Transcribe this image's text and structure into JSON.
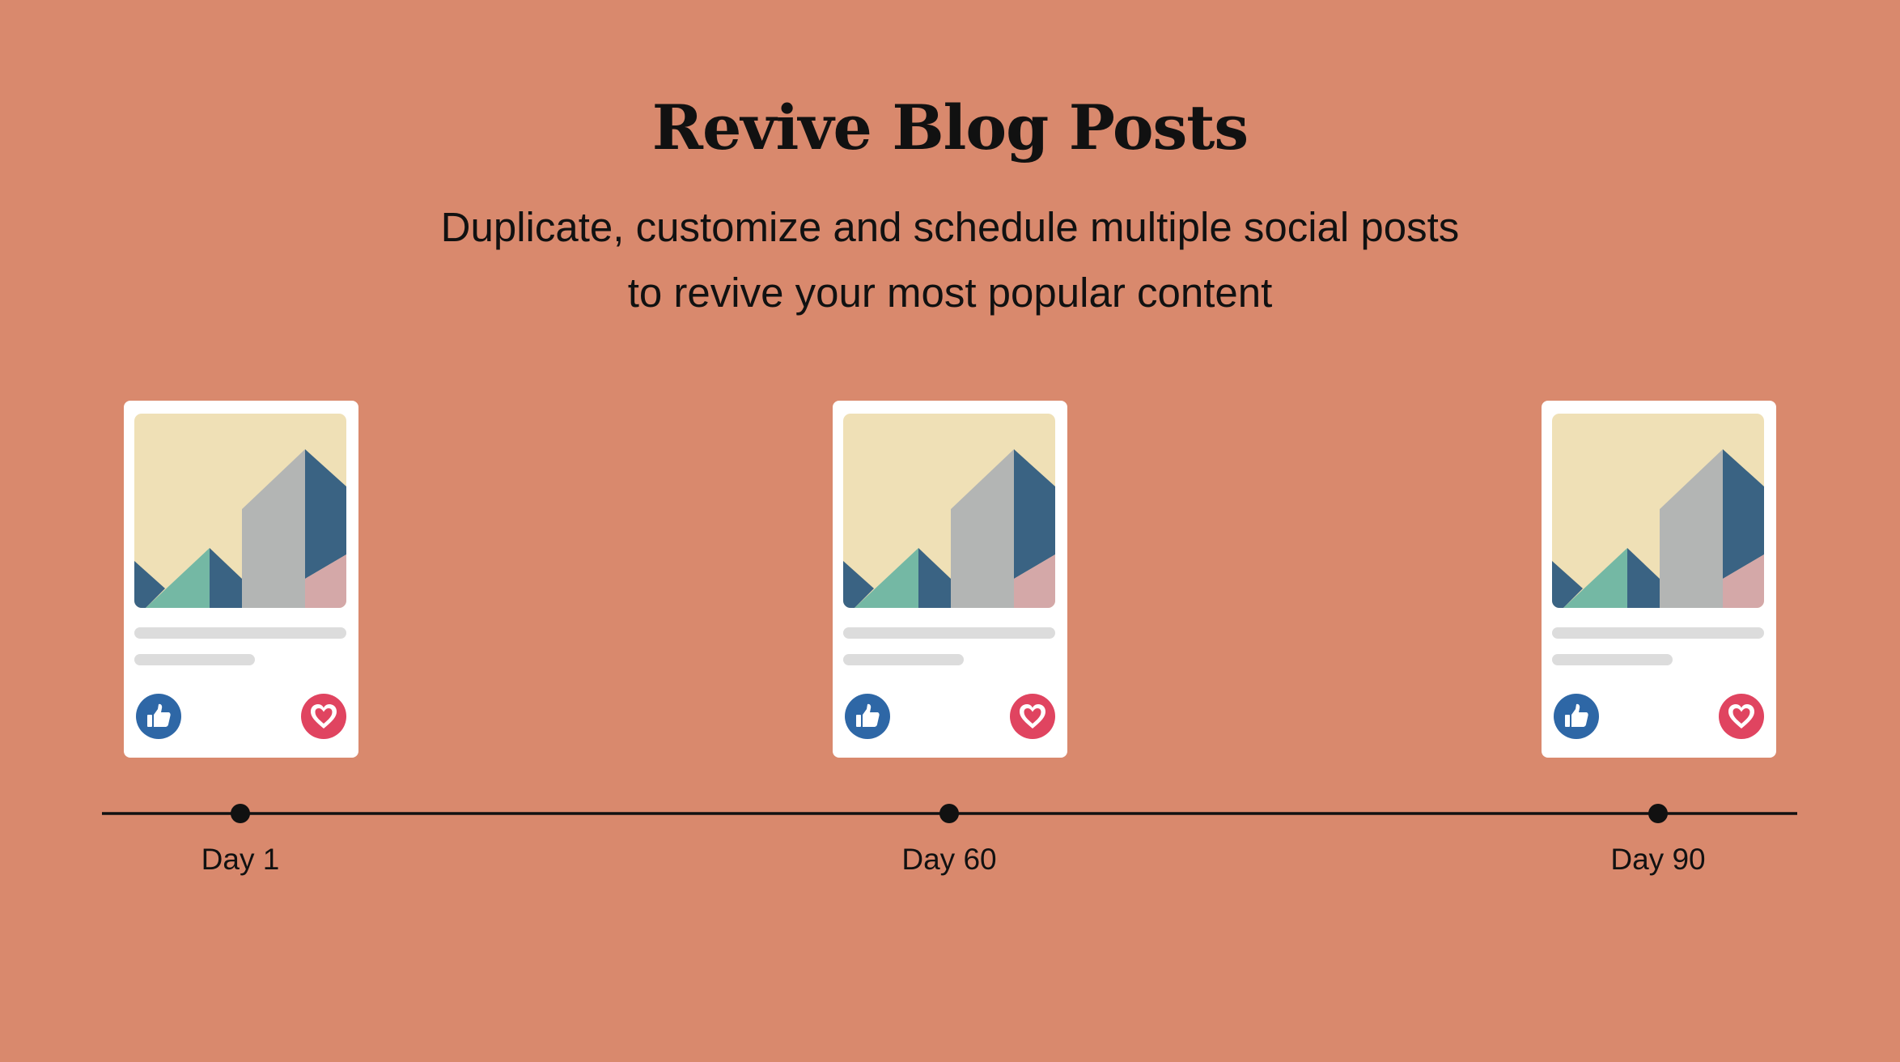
{
  "colors": {
    "background": "#d9896d",
    "card": "#ffffff",
    "thumb_sky": "#efe0b6",
    "thumb_navy": "#3a6383",
    "thumb_teal": "#74b8a4",
    "thumb_gray": "#b3b5b4",
    "thumb_pink": "#d4a8a8",
    "text_line": "#dcdcdc",
    "like": "#2e67a6",
    "heart": "#e04460",
    "timeline": "#111111"
  },
  "header": {
    "title": "Revive Blog Posts",
    "subtitle_line1": "Duplicate, customize and schedule multiple social posts",
    "subtitle_line2": "to revive your most popular content"
  },
  "posts": [
    {
      "icons": [
        "image-thumbnail",
        "thumbs-up-icon",
        "heart-icon"
      ]
    },
    {
      "icons": [
        "image-thumbnail",
        "thumbs-up-icon",
        "heart-icon"
      ]
    },
    {
      "icons": [
        "image-thumbnail",
        "thumbs-up-icon",
        "heart-icon"
      ]
    }
  ],
  "timeline": {
    "ticks": [
      {
        "label": "Day 1"
      },
      {
        "label": "Day 60"
      },
      {
        "label": "Day 90"
      }
    ]
  }
}
